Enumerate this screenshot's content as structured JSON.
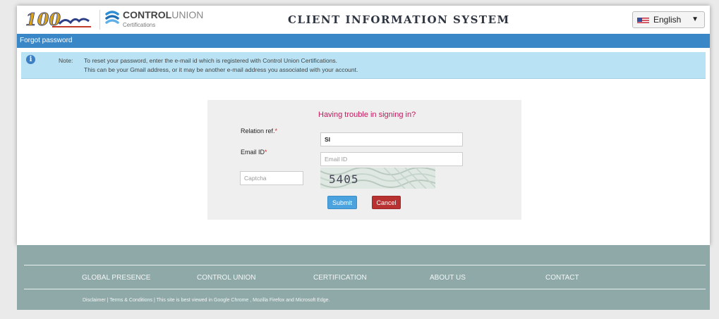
{
  "header": {
    "logo_100_alt": "100",
    "brand_bold": "CONTROL",
    "brand_light": "UNION",
    "brand_sub": "Certifications",
    "system_title": "CLIENT INFORMATION SYSTEM",
    "language": {
      "selected": "English",
      "flag_icon": "us-flag-icon"
    }
  },
  "titlebar": {
    "title": "Forgot password"
  },
  "note": {
    "icon": "info-icon",
    "label": "Note:",
    "line1": "To reset your password, enter the e-mail id which is registered with Control Union Certifications.",
    "line2": "This can be your Gmail address, or it may be another e-mail address you associated with your account."
  },
  "form": {
    "heading": "Having trouble in signing in?",
    "relation_label": "Relation ref.",
    "relation_value": "SI",
    "email_label": "Email ID",
    "email_placeholder": "Email ID",
    "captcha_placeholder": "Captcha",
    "captcha_code": "5405",
    "required_mark": "*",
    "submit_label": "Submit",
    "cancel_label": "Cancel"
  },
  "footer": {
    "nav": [
      "GLOBAL PRESENCE",
      "CONTROL UNION",
      "CERTIFICATION",
      "ABOUT US",
      "CONTACT"
    ],
    "disclaimer": "Disclaimer",
    "terms": "Terms & Conditions",
    "separator": "|",
    "browser_note": "This site is best viewed in Google Chrome , Mozilla Firefox and Microsoft Edge."
  },
  "colors": {
    "title_bar": "#3a87c8",
    "note_bg": "#b9e3f4",
    "heading": "#c2185b",
    "submit": "#4aa3df",
    "cancel": "#b83232",
    "footer": "#8fa9a9"
  }
}
